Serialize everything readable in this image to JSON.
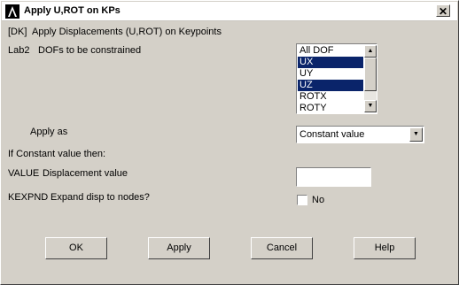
{
  "window": {
    "title": "Apply U,ROT on KPs",
    "close_glyph": "✕"
  },
  "header": {
    "tag": "[DK]",
    "description": "Apply Displacements (U,ROT) on Keypoints"
  },
  "lab2": {
    "key": "Lab2",
    "label": "DOFs to be constrained",
    "options": [
      "All DOF",
      "UX",
      "UY",
      "UZ",
      "ROTX",
      "ROTY"
    ],
    "selected": [
      "UX",
      "UZ"
    ]
  },
  "apply_as": {
    "label": "Apply as",
    "value": "Constant value"
  },
  "constant_section": {
    "heading": "If Constant value then:"
  },
  "value_field": {
    "key": "VALUE",
    "label": "Displacement value",
    "value": ""
  },
  "kexpnd": {
    "key": "KEXPND",
    "label": "Expand disp to nodes?",
    "checkbox_label": "No",
    "checked": false
  },
  "buttons": {
    "ok": "OK",
    "apply": "Apply",
    "cancel": "Cancel",
    "help": "Help"
  },
  "icons": {
    "app": "ansys-logo-icon",
    "scroll_up": "▲",
    "scroll_down": "▼",
    "dropdown": "▼"
  },
  "colors": {
    "selection": "#0a246a",
    "dialog_bg": "#d4d0c8"
  }
}
